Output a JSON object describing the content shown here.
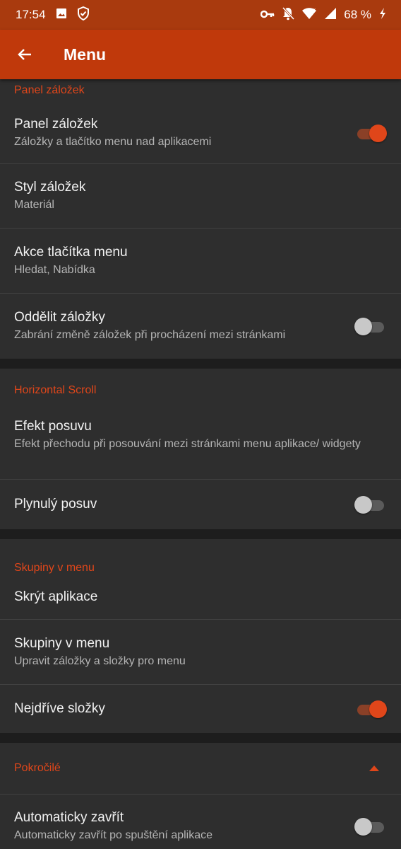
{
  "status_bar": {
    "time": "17:54",
    "battery_percent": "68 %",
    "icons": [
      "image-icon",
      "shield-icon",
      "key-icon",
      "bell-off-icon",
      "wifi-icon",
      "signal-icon",
      "charging-icon"
    ]
  },
  "app_bar": {
    "title": "Menu"
  },
  "sections": [
    {
      "header": "Panel záložek",
      "items": [
        {
          "title": "Panel záložek",
          "subtitle": "Záložky a tlačítko menu nad aplikacemi",
          "toggle": true
        },
        {
          "title": "Styl záložek",
          "subtitle": "Materiál"
        },
        {
          "title": "Akce tlačítka menu",
          "subtitle": "Hledat, Nabídka"
        },
        {
          "title": "Oddělit záložky",
          "subtitle": "Zabrání změně záložek při procházení mezi stránkami",
          "toggle": false
        }
      ]
    },
    {
      "header": "Horizontal Scroll",
      "items": [
        {
          "title": "Efekt posuvu",
          "subtitle": "Efekt přechodu při posouvání mezi stránkami menu aplikace/ widgety"
        },
        {
          "title": "Plynulý posuv",
          "toggle": false
        }
      ]
    },
    {
      "header": "Skupiny v menu",
      "items": [
        {
          "title": "Skrýt aplikace"
        },
        {
          "title": "Skupiny v menu",
          "subtitle": "Upravit záložky a složky pro menu"
        },
        {
          "title": "Nejdříve složky",
          "toggle": true
        }
      ]
    },
    {
      "header": "Pokročilé",
      "items": [
        {
          "title": "Automaticky zavřít",
          "subtitle": "Automaticky zavřít po spuštění aplikace",
          "toggle": false
        }
      ]
    }
  ],
  "colors": {
    "accent": "#e0461a",
    "app_bar": "#c0390b",
    "status_bar": "#a93a0e",
    "surface": "#2e2e2e",
    "background": "#1d1d1d"
  }
}
